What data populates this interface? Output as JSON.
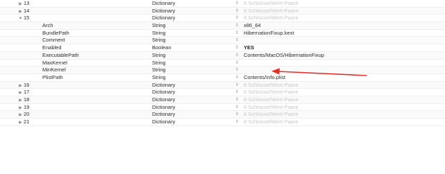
{
  "rows": [
    {
      "key": "13",
      "indent": 0,
      "expander": "▶",
      "type": "Dictionary",
      "stepper": "⇕",
      "value": "8 Schlüssel/Wert-Paare",
      "muted": true
    },
    {
      "key": "14",
      "indent": 0,
      "expander": "▶",
      "type": "Dictionary",
      "stepper": "⇕",
      "value": "8 Schlüssel/Wert-Paare",
      "muted": true
    },
    {
      "key": "15",
      "indent": 0,
      "expander": "▼",
      "type": "Dictionary",
      "stepper": "⇕",
      "value": "8 Schlüssel/Wert-Paare",
      "muted": true
    },
    {
      "key": "Arch",
      "indent": 1,
      "expander": "",
      "type": "String",
      "stepper": "⇕",
      "value": "x86_64",
      "muted": false
    },
    {
      "key": "BundlePath",
      "indent": 1,
      "expander": "",
      "type": "String",
      "stepper": "⇕",
      "value": "HibernationFixup.kext",
      "muted": false
    },
    {
      "key": "Comment",
      "indent": 1,
      "expander": "",
      "type": "String",
      "stepper": "⇕",
      "value": "",
      "muted": false
    },
    {
      "key": "Enabled",
      "indent": 1,
      "expander": "",
      "type": "Boolean",
      "stepper": "⇕",
      "value": "YES",
      "muted": false,
      "bold": true
    },
    {
      "key": "ExecutablePath",
      "indent": 1,
      "expander": "",
      "type": "String",
      "stepper": "⇕",
      "value": "Contents/MacOS/HibernationFixup",
      "muted": false
    },
    {
      "key": "MaxKernel",
      "indent": 1,
      "expander": "",
      "type": "String",
      "stepper": "⇕",
      "value": "",
      "muted": false
    },
    {
      "key": "MinKernel",
      "indent": 1,
      "expander": "",
      "type": "String",
      "stepper": "⇕",
      "value": "",
      "muted": false
    },
    {
      "key": "PlistPath",
      "indent": 1,
      "expander": "",
      "type": "String",
      "stepper": "⇕",
      "value": "Contents/Info.plist",
      "muted": false
    },
    {
      "key": "16",
      "indent": 0,
      "expander": "▶",
      "type": "Dictionary",
      "stepper": "⇕",
      "value": "8 Schlüssel/Wert-Paare",
      "muted": true
    },
    {
      "key": "17",
      "indent": 0,
      "expander": "▶",
      "type": "Dictionary",
      "stepper": "⇕",
      "value": "8 Schlüssel/Wert-Paare",
      "muted": true
    },
    {
      "key": "18",
      "indent": 0,
      "expander": "▶",
      "type": "Dictionary",
      "stepper": "⇕",
      "value": "8 Schlüssel/Wert-Paare",
      "muted": true
    },
    {
      "key": "19",
      "indent": 0,
      "expander": "▶",
      "type": "Dictionary",
      "stepper": "⇕",
      "value": "8 Schlüssel/Wert-Paare",
      "muted": true
    },
    {
      "key": "20",
      "indent": 0,
      "expander": "▶",
      "type": "Dictionary",
      "stepper": "⇕",
      "value": "8 Schlüssel/Wert-Paare",
      "muted": true
    },
    {
      "key": "21",
      "indent": 0,
      "expander": "▶",
      "type": "Dictionary",
      "stepper": "⇕",
      "value": "8 Schlüssel/Wert-Paare",
      "muted": true
    }
  ],
  "annotation": {
    "icon": "red-arrow-icon",
    "color": "#e0302a"
  },
  "colors": {
    "muted_text": "#c8c8c8",
    "text": "#2a2a2a",
    "divider": "#efefef"
  }
}
